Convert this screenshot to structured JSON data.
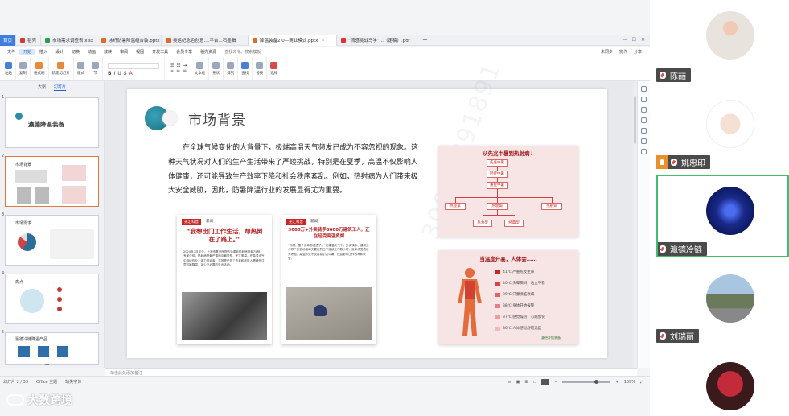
{
  "tabs": [
    {
      "label": "稻壳",
      "color": "#d33"
    },
    {
      "label": "市场需求调查表.xlsx",
      "color": "#2e9a4d"
    },
    {
      "label": "冰纤防暑降温组合装.pptx",
      "color": "#e06a2c"
    },
    {
      "label": "奥运纪念色创意....平台...石墨辑",
      "color": "#e06a2c"
    },
    {
      "label": "降温装备2.0—商业模式.pptx",
      "color": "#e06a2c",
      "active": true
    },
    {
      "label": "“流感挑战马学”...（定稿）.pdf",
      "color": "#d33"
    }
  ],
  "menu": {
    "items": [
      "文件",
      "开始",
      "插入",
      "设计",
      "切换",
      "动画",
      "放映",
      "审阅",
      "视图",
      "开发工具",
      "会员专享",
      "稻壳资源"
    ],
    "search": "查找命令、搜索模板",
    "right": [
      "未同步",
      "协作",
      "分享"
    ]
  },
  "ribbon": {
    "groups": [
      "粘贴",
      "复制",
      "格式刷",
      "新建幻灯片",
      "版式",
      "节",
      "重置",
      "文本框",
      "形状",
      "排列",
      "查找",
      "替换",
      "选择"
    ],
    "font_size": "0"
  },
  "leftpanel": {
    "tabs": [
      "大纲",
      "幻灯片"
    ],
    "thumbs": [
      {
        "num": "1",
        "title": "瀛德降温装备"
      },
      {
        "num": "2",
        "title": "市场背景"
      },
      {
        "num": "3",
        "title": "市场需求"
      },
      {
        "num": "4",
        "title": "痛点"
      },
      {
        "num": "5",
        "title": "瀛德冷链降温产品"
      }
    ]
  },
  "slide": {
    "title": "市场背景",
    "paragraph": "在全球气候变化的大背景下，极端高温天气频发已成为不容忽视的现象。这种天气状况对人们的生产生活带来了严峻挑战，特别是在夏季，高温不仅影响人体健康，还可能导致生产效率下降和社会秩序紊乱。例如，热射病为人们带来极大安全威胁，因此，防暑降温行业的发展显得尤为重要。",
    "watermark": "30022391891",
    "card1": {
      "badge": "光汇科普",
      "badge2": "新闻",
      "headline": "“我想出门工作生活，却热倒在了路上。”",
      "body": "2024年7月至今，上海市累计医院收治重症热射病患者75例。专家介绍，热射病是最严重的中暑类型，死亡率高。在高温天气中持续作业、体力劳动者，尤其是户外工作者和老年人需格外注意防暑降温，减少不必要的外出活动。"
    },
    "card2": {
      "badge": "光汇科普",
      "badge2": "新闻",
      "headline": "3000万+外卖骑手5000万建筑工人，正在经受高温炙烤",
      "body": "“热啊，整个身体都湿透了。”在高温天气下，外卖骑手、建筑工人等户外劳动者每天要在烈日下连续工作数小时，身体承受着巨大考验。高温作业不仅容易引发中暑，还会影响工作效率和安全。"
    },
    "chart1": {
      "title": "从先兆中暑到热射病↓",
      "nodes": [
        "先兆中暑",
        "轻症中暑",
        "重症中暑",
        "热痉挛",
        "热衰竭",
        "热射病",
        "热力型",
        "经典型"
      ]
    },
    "chart2": {
      "title": "当温度升高，人体会……",
      "items": [
        "41℃ 严重危及生命",
        "40℃ 头晕胸闷，站立不稳",
        "39℃ 汗腺濒临衰竭",
        "38℃ 身体开始报警",
        "37℃ 感觉燥热，心跳加快",
        "36℃ 人体感觉舒适温度"
      ],
      "footer": "瀛德冷链装备"
    }
  },
  "notes_placeholder": "单击此处添加备注",
  "status": {
    "slide_counter": "幻灯片 2 / 33",
    "theme": "Office 主题",
    "font_missing": "缺失字体",
    "zoom": "109%"
  },
  "watermark_logo": "大数跨境",
  "participants": [
    {
      "name": "陈喆",
      "host": false
    },
    {
      "name": "姚忠印",
      "host": true
    },
    {
      "name": "瀛德冷链",
      "host": false,
      "active": true
    },
    {
      "name": "刘瑞丽",
      "host": false
    },
    {
      "name": "",
      "host": false
    }
  ]
}
